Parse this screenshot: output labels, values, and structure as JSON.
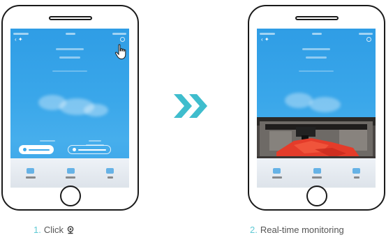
{
  "steps": [
    {
      "number": "1.",
      "text": "Click",
      "icon": "cloud-camera-icon"
    },
    {
      "number": "2.",
      "text": "Real-time monitoring"
    }
  ],
  "colors": {
    "accent_teal": "#3fbdcd",
    "screen_blue": "#3aa7ea",
    "step_number": "#5ec9d4"
  },
  "icons": {
    "transition": "double-chevron-right-icon",
    "tap": "tap-hand-icon",
    "settings": "settings-icon"
  }
}
